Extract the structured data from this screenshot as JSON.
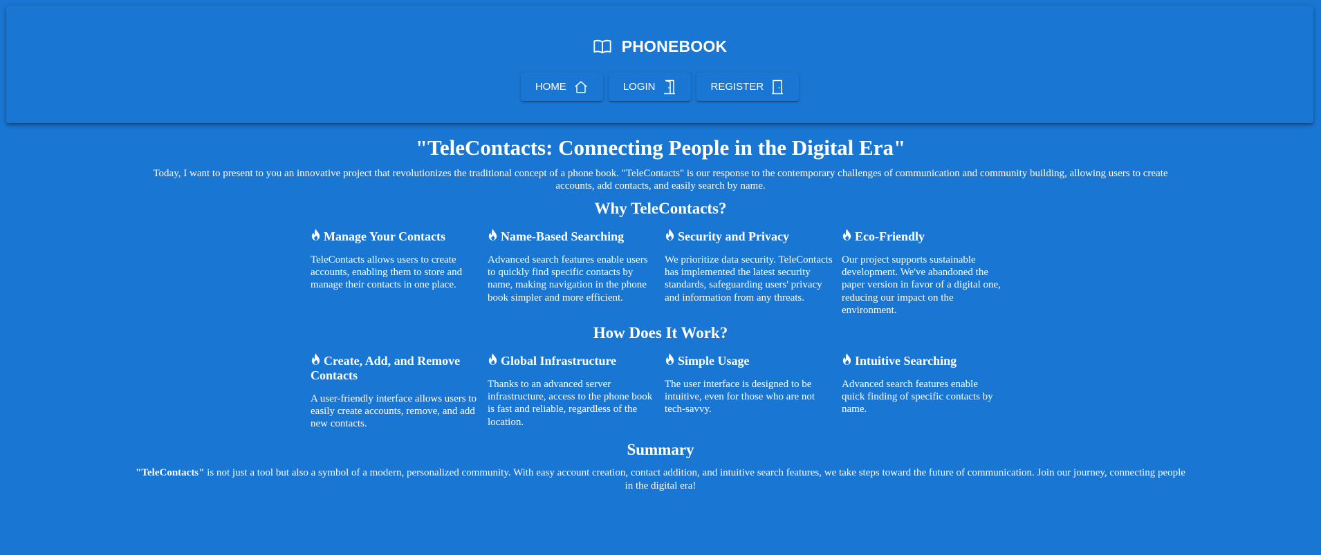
{
  "header": {
    "brand_icon": "open-book-icon",
    "brand_title": "PHONEBOOK",
    "nav": [
      {
        "label": "HOME",
        "icon": "house-icon"
      },
      {
        "label": "LOGIN",
        "icon": "door-icon"
      },
      {
        "label": "REGISTER",
        "icon": "door-icon"
      }
    ]
  },
  "main": {
    "title": "\"TeleContacts: Connecting People in the Digital Era\"",
    "intro": "Today, I want to present to you an innovative project that revolutionizes the traditional concept of a phone book. \"TeleContacts\" is our response to the contemporary challenges of communication and community building, allowing users to create accounts, add contacts, and easily search by name."
  },
  "why": {
    "title": "Why TeleContacts?",
    "items": [
      {
        "title": "Manage Your Contacts",
        "text": "TeleContacts allows users to create accounts, enabling them to store and manage their contacts in one place."
      },
      {
        "title": "Name-Based Searching",
        "text": "Advanced search features enable users to quickly find specific contacts by name, making navigation in the phone book simpler and more efficient."
      },
      {
        "title": "Security and Privacy",
        "text": "We prioritize data security. TeleContacts has implemented the latest security standards, safeguarding users' privacy and information from any threats."
      },
      {
        "title": "Eco-Friendly",
        "text": "Our project supports sustainable development. We've abandoned the paper version in favor of a digital one, reducing our impact on the environment."
      }
    ]
  },
  "how": {
    "title": "How Does It Work?",
    "items": [
      {
        "title": "Create, Add, and Remove Contacts",
        "text": "A user-friendly interface allows users to easily create accounts, remove, and add new contacts."
      },
      {
        "title": "Global Infrastructure",
        "text": "Thanks to an advanced server infrastructure, access to the phone book is fast and reliable, regardless of the location."
      },
      {
        "title": "Simple Usage",
        "text": "The user interface is designed to be intuitive, even for those who are not tech-savvy."
      },
      {
        "title": "Intuitive Searching",
        "text": "Advanced search features enable quick finding of specific contacts by name."
      }
    ]
  },
  "summary": {
    "title": "Summary",
    "lead": "\"TeleContacts\"",
    "text": " is not just a tool but also a symbol of a modern, personalized community. With easy account creation, contact addition, and intuitive search features, we take steps toward the future of communication. Join our journey, connecting people in the digital era!"
  },
  "feature_icon": "flame-icon",
  "colors": {
    "background": "#1976d2",
    "text": "#ffffff"
  }
}
